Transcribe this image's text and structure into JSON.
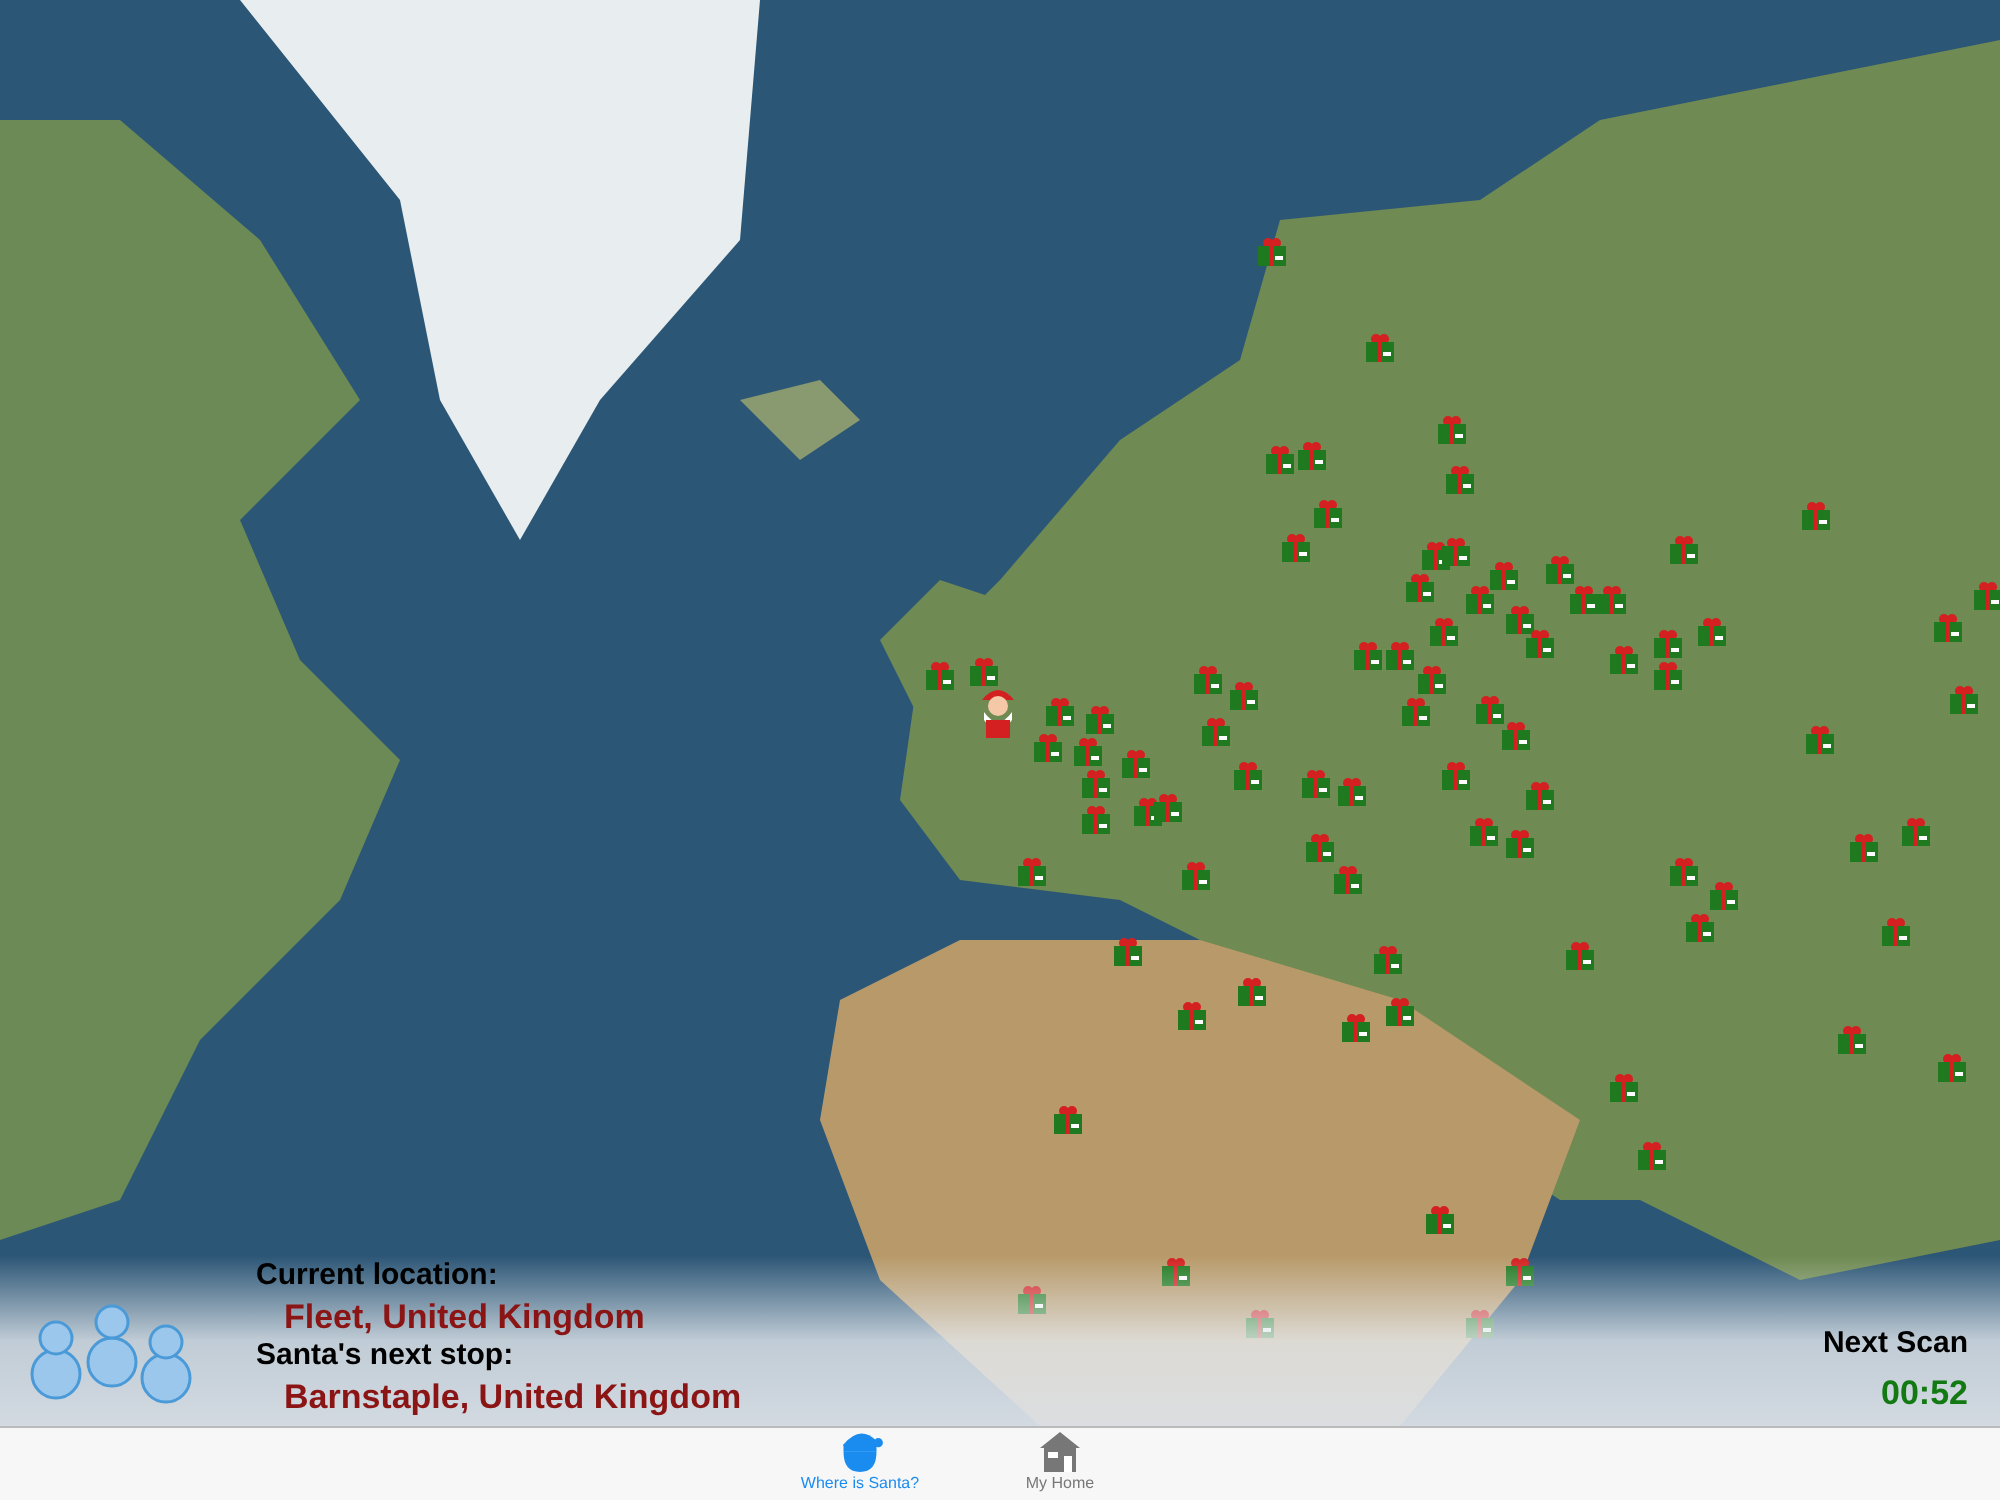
{
  "info_panel": {
    "current_location_label": "Current location:",
    "current_location": "Fleet, United Kingdom",
    "next_stop_label": "Santa's next stop:",
    "next_stop": "Barnstaple, United Kingdom"
  },
  "next_scan": {
    "label": "Next Scan",
    "countdown": "00:52"
  },
  "tabs": [
    {
      "label": "Where is Santa?",
      "kind": "santa",
      "selected": true
    },
    {
      "label": "My Home",
      "kind": "home",
      "selected": false
    }
  ]
}
